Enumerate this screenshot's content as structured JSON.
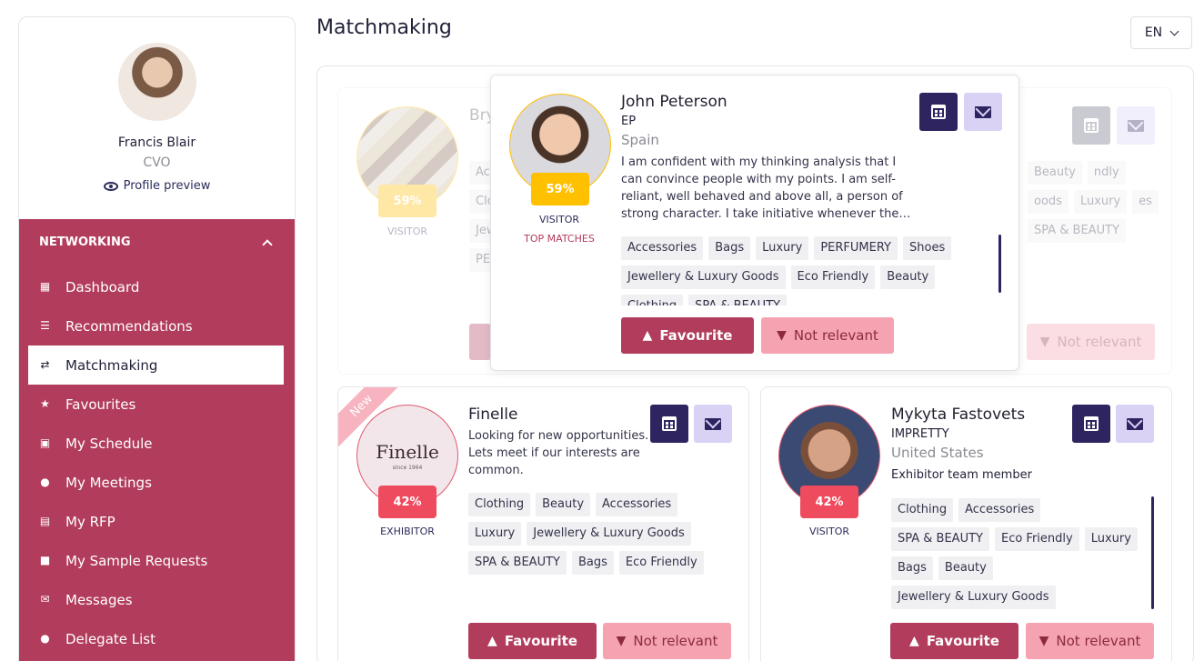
{
  "profile": {
    "name": "Francis Blair",
    "role": "CVO",
    "preview_label": "Profile preview"
  },
  "nav": {
    "section": "NETWORKING",
    "items": [
      {
        "label": "Dashboard",
        "icon": "dashboard-icon"
      },
      {
        "label": "Recommendations",
        "icon": "list-icon"
      },
      {
        "label": "Matchmaking",
        "icon": "matchmaking-icon"
      },
      {
        "label": "Favourites",
        "icon": "star-icon"
      },
      {
        "label": "My Schedule",
        "icon": "calendar-icon"
      },
      {
        "label": "My Meetings",
        "icon": "meetings-icon"
      },
      {
        "label": "My RFP",
        "icon": "rfp-icon"
      },
      {
        "label": "My Sample Requests",
        "icon": "gift-icon"
      },
      {
        "label": "Messages",
        "icon": "envelope-icon"
      },
      {
        "label": "Delegate List",
        "icon": "people-icon"
      }
    ]
  },
  "header": {
    "title": "Matchmaking",
    "lang": "EN"
  },
  "bg_card": {
    "name_partial": "Bry",
    "pct": "59%",
    "type": "VISITOR",
    "tags_left": [
      "Ac",
      "Clo",
      "Jew",
      "PE"
    ],
    "tags_right": [
      "Beauty",
      "ndly",
      "oods",
      "Luxury",
      "es",
      "SPA & BEAUTY"
    ],
    "nr_label": "Not relevant"
  },
  "popup": {
    "name": "John Peterson",
    "company": "EP",
    "country": "Spain",
    "description": "I am confident with my thinking analysis that I can convince people with my points. I am self-reliant, well behaved and above all, a person of strong character. I take initiative whenever the…",
    "pct": "59%",
    "type": "VISITOR",
    "badge": "TOP MATCHES",
    "tags": [
      "Accessories",
      "Bags",
      "Luxury",
      "PERFUMERY",
      "Shoes",
      "Jewellery & Luxury Goods",
      "Eco Friendly",
      "Beauty",
      "Clothing",
      "SPA & BEAUTY"
    ],
    "fav_label": "Favourite",
    "nr_label": "Not relevant"
  },
  "cards": [
    {
      "ribbon": "New",
      "name": "Finelle",
      "logo_text": "Finelle",
      "logo_sub": "since 1964",
      "description": "Looking for new opportunities. Lets meet if our interests are common.",
      "pct": "42%",
      "type": "EXHIBITOR",
      "tags": [
        "Clothing",
        "Beauty",
        "Accessories",
        "Luxury",
        "Jewellery & Luxury Goods",
        "SPA & BEAUTY",
        "Bags",
        "Eco Friendly"
      ],
      "fav_label": "Favourite",
      "nr_label": "Not relevant"
    },
    {
      "name": "Mykyta Fastovets",
      "company": "IMPRETTY",
      "country": "United States",
      "role_text": "Exhibitor team member",
      "pct": "42%",
      "type": "VISITOR",
      "tags": [
        "Clothing",
        "Accessories",
        "SPA & BEAUTY",
        "Eco Friendly",
        "Luxury",
        "Bags",
        "Beauty",
        "Jewellery & Luxury Goods"
      ],
      "fav_label": "Favourite",
      "nr_label": "Not relevant"
    }
  ],
  "colors": {
    "accent": "#b23c5b",
    "navy": "#2e2460",
    "lavender": "#d9d2f5",
    "match_red": "#ef4b5f",
    "match_yellow": "#ffc000"
  }
}
